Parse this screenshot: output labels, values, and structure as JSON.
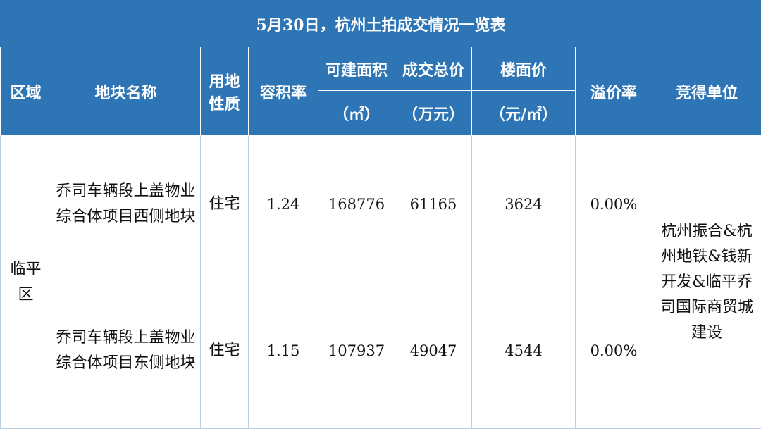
{
  "title": "5月30日，杭州土拍成交情况一览表",
  "headers": {
    "region": "区域",
    "parcel_name": "地块名称",
    "land_use_line1": "用地",
    "land_use_line2": "性质",
    "far": "容积率",
    "buildable_area": "可建面积",
    "buildable_area_unit": "（㎡）",
    "total_price": "成交总价",
    "total_price_unit": "（万元）",
    "floor_price": "楼面价",
    "floor_price_unit": "（元/㎡）",
    "premium_rate": "溢价率",
    "winner": "竞得单位"
  },
  "region": "临平区",
  "winner": "杭州振合&杭州地铁&钱新开发&临平乔司国际商贸城建设",
  "rows": [
    {
      "parcel_name": "乔司车辆段上盖物业综合体项目西侧地块",
      "land_use": "住宅",
      "far": "1.24",
      "buildable_area": "168776",
      "total_price": "61165",
      "floor_price": "3624",
      "premium_rate": "0.00%"
    },
    {
      "parcel_name": "乔司车辆段上盖物业综合体项目东侧地块",
      "land_use": "住宅",
      "far": "1.15",
      "buildable_area": "107937",
      "total_price": "49047",
      "floor_price": "4544",
      "premium_rate": "0.00%"
    }
  ],
  "colors": {
    "header_bg": "#2e75b6",
    "header_text": "#ffffff",
    "grid": "#b8cfe6"
  }
}
